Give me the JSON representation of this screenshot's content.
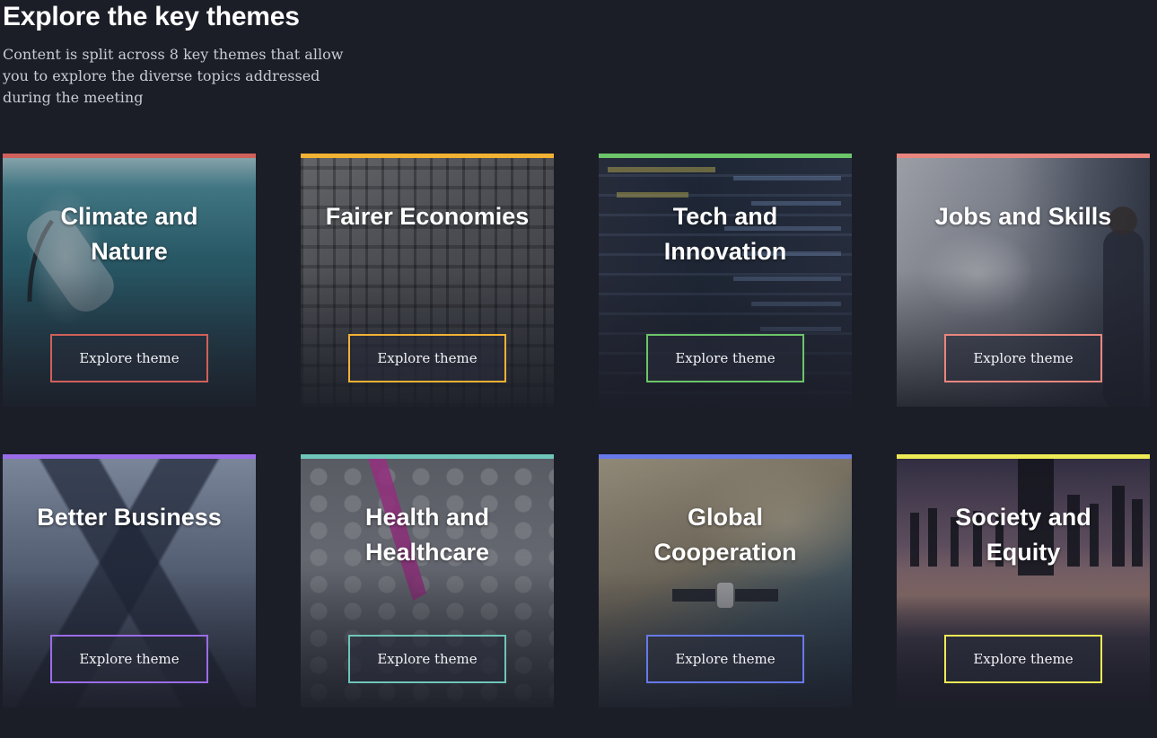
{
  "header": {
    "title": "Explore the key themes",
    "intro": "Content is split across 8 key themes that allow you to explore the diverse topics addressed during the meeting"
  },
  "themes": [
    {
      "title_line1": "Climate and",
      "title_line2": "Nature",
      "button_label": "Explore theme",
      "accent": "#d0605a"
    },
    {
      "title_line1": "Fairer Economies",
      "title_line2": "",
      "button_label": "Explore theme",
      "accent": "#f2b233"
    },
    {
      "title_line1": "Tech and",
      "title_line2": "Innovation",
      "button_label": "Explore theme",
      "accent": "#6cc569"
    },
    {
      "title_line1": "Jobs and Skills",
      "title_line2": "",
      "button_label": "Explore theme",
      "accent": "#e9867f"
    },
    {
      "title_line1": "Better Business",
      "title_line2": "",
      "button_label": "Explore theme",
      "accent": "#9b6ce8"
    },
    {
      "title_line1": "Health and",
      "title_line2": "Healthcare",
      "button_label": "Explore theme",
      "accent": "#6ec5b9"
    },
    {
      "title_line1": "Global",
      "title_line2": "Cooperation",
      "button_label": "Explore theme",
      "accent": "#6879ea"
    },
    {
      "title_line1": "Society and",
      "title_line2": "Equity",
      "button_label": "Explore theme",
      "accent": "#eeea55"
    }
  ]
}
